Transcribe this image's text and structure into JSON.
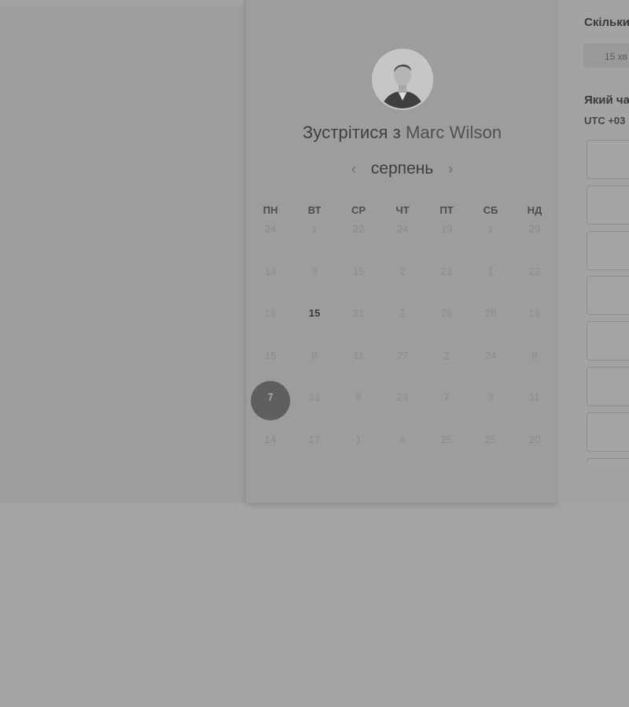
{
  "header": {
    "title_prefix": "Зустрітися з",
    "title_name": "Marc Wilson"
  },
  "calendar": {
    "month": "серпень",
    "prev_icon": "‹",
    "next_icon": "›",
    "weekdays": [
      "ПН",
      "ВТ",
      "СР",
      "ЧТ",
      "ПТ",
      "СБ",
      "НД"
    ],
    "weeks": [
      [
        "24",
        "1",
        "22",
        "24",
        "19",
        "1",
        "29"
      ],
      [
        "14",
        "9",
        "15",
        "2",
        "21",
        "1",
        "22"
      ],
      [
        "16",
        "15",
        "31",
        "2",
        "26",
        "28",
        "16"
      ],
      [
        "15",
        "9",
        "11",
        "27",
        "2",
        "24",
        "8"
      ],
      [
        "7",
        "31",
        "6",
        "24",
        "7",
        "9",
        "11"
      ],
      [
        "14",
        "17",
        "1",
        "6",
        "25",
        "25",
        "20"
      ]
    ],
    "active_day": "15",
    "selected_day": "7"
  },
  "sidebar": {
    "duration_label": "Скільки",
    "duration_option": "15 хв",
    "time_label": "Який ча",
    "timezone": "UTC +03",
    "slot_count": 8
  }
}
